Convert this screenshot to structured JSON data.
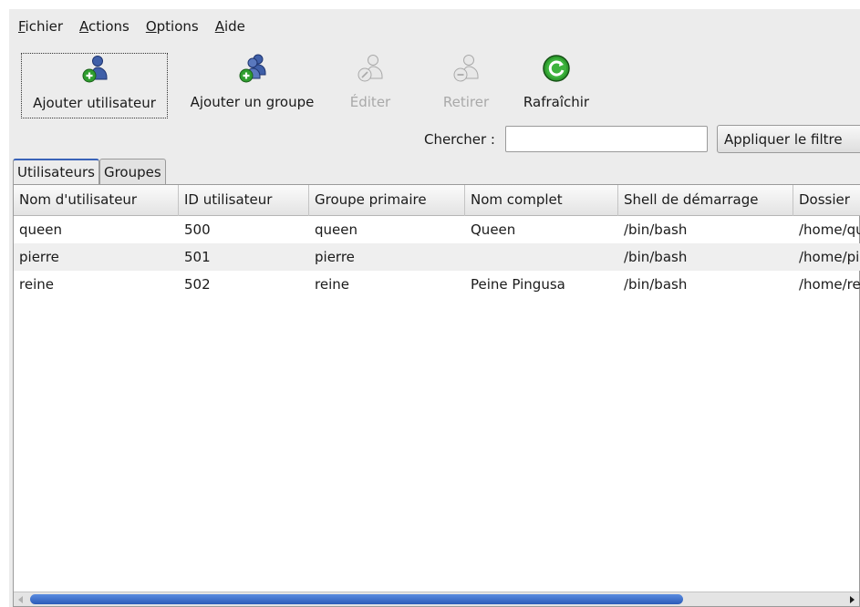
{
  "menubar": {
    "items": [
      {
        "label": "Fichier",
        "underline": "F"
      },
      {
        "label": "Actions",
        "underline": "A"
      },
      {
        "label": "Options",
        "underline": "O"
      },
      {
        "label": "Aide",
        "underline": "A"
      }
    ]
  },
  "toolbar": {
    "add_user": "Ajouter utilisateur",
    "add_group": "Ajouter un groupe",
    "edit": "Éditer",
    "remove": "Retirer",
    "refresh": "Rafraîchir"
  },
  "search": {
    "label": "Chercher :",
    "value": "",
    "filter_button": "Appliquer le filtre"
  },
  "tabs": [
    "Utilisateurs",
    "Groupes"
  ],
  "table": {
    "columns": [
      "Nom d'utilisateur",
      "ID utilisateur",
      "Groupe primaire",
      "Nom complet",
      "Shell de démarrage",
      "Dossier"
    ],
    "rows": [
      [
        "queen",
        "500",
        "queen",
        "Queen",
        "/bin/bash",
        "/home/queen"
      ],
      [
        "pierre",
        "501",
        "pierre",
        "",
        "/bin/bash",
        "/home/pierre"
      ],
      [
        "reine",
        "502",
        "reine",
        "Peine Pingusa",
        "/bin/bash",
        "/home/reine"
      ]
    ]
  },
  "colors": {
    "user_icon": "#3f5fa8",
    "disabled": "#a9a9a9",
    "refresh_green": "#2f9e2f",
    "scroll_thumb": "#2b5bb8"
  },
  "icons": {
    "add_user": "user-add-icon",
    "add_group": "group-add-icon",
    "edit": "user-edit-icon",
    "remove": "user-remove-icon",
    "refresh": "refresh-icon"
  }
}
